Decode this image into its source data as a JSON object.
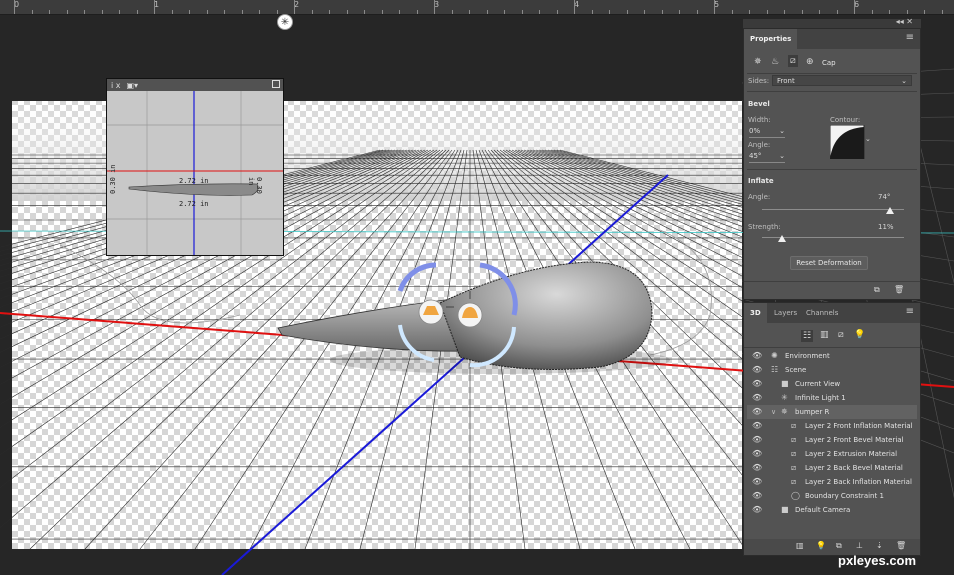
{
  "ruler": {
    "labels": [
      "0",
      "1",
      "2",
      "3",
      "4",
      "5",
      "6"
    ]
  },
  "secondary_view": {
    "dim_top": "2.72 in",
    "dim_bottom": "2.72 in",
    "dim_left": "0.30 in",
    "dim_right": "0.30 in",
    "menu_label": "i x"
  },
  "properties": {
    "title": "Properties",
    "mode_label": "Cap",
    "sides_label": "Sides:",
    "sides_value": "Front",
    "bevel_header": "Bevel",
    "width_label": "Width:",
    "width_value": "0%",
    "contour_label": "Contour:",
    "angle_label": "Angle:",
    "angle_value": "45°",
    "inflate_header": "Inflate",
    "inflate_angle_label": "Angle:",
    "inflate_angle_value": "74°",
    "inflate_angle_fraction": 0.9,
    "strength_label": "Strength:",
    "strength_value": "11%",
    "strength_fraction": 0.14,
    "reset_button": "Reset Deformation"
  },
  "layers_panel": {
    "tabs": [
      "3D",
      "Layers",
      "Channels"
    ],
    "rows": [
      {
        "label": "Environment",
        "indent": 0,
        "icon": "environment-icon"
      },
      {
        "label": "Scene",
        "indent": 0,
        "icon": "scene-icon"
      },
      {
        "label": "Current View",
        "indent": 1,
        "icon": "camera-icon"
      },
      {
        "label": "Infinite Light 1",
        "indent": 1,
        "icon": "light-icon"
      },
      {
        "label": "bumper R",
        "indent": 1,
        "icon": "mesh-icon",
        "selected": true
      },
      {
        "label": "Layer 2 Front Inflation Material",
        "indent": 2,
        "icon": "material-icon"
      },
      {
        "label": "Layer 2 Front Bevel Material",
        "indent": 2,
        "icon": "material-icon"
      },
      {
        "label": "Layer 2 Extrusion Material",
        "indent": 2,
        "icon": "material-icon"
      },
      {
        "label": "Layer 2 Back Bevel Material",
        "indent": 2,
        "icon": "material-icon"
      },
      {
        "label": "Layer 2 Back Inflation Material",
        "indent": 2,
        "icon": "material-icon"
      },
      {
        "label": "Boundary Constraint 1",
        "indent": 2,
        "icon": "constraint-icon"
      },
      {
        "label": "Default Camera",
        "indent": 1,
        "icon": "camera-icon"
      }
    ]
  },
  "watermark": "pxleyes.com"
}
